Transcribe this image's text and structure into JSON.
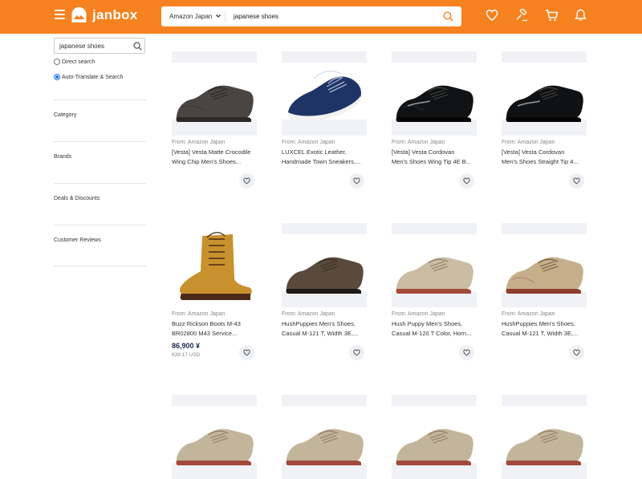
{
  "header": {
    "logo_text": "janbox",
    "brand_color": "#f5821f",
    "search": {
      "store": "Amazon Japan",
      "query": "japanese shoes"
    },
    "icons": [
      "heart-icon",
      "auction-hammer-icon",
      "cart-icon",
      "bell-icon"
    ]
  },
  "sidebar": {
    "search_value": "japanese shoes",
    "search_mode": {
      "options": [
        "Direct search",
        "Auto-Translate & Search"
      ],
      "selected": "Auto-Translate & Search"
    },
    "filters": [
      "Category",
      "Brands",
      "Deals & Discounts",
      "Customer Reviews"
    ]
  },
  "products": [
    {
      "source": "From: Amazon Japan",
      "title_line1": "[Vesta] Vesta Matte Crocodile",
      "title_line2": "Wing Chip Men's Shoes...",
      "shoe": "dark-croc-oxford"
    },
    {
      "source": "From: Amazon Japan",
      "title_line1": "LUXCEL Exotic Leather,",
      "title_line2": "Handmade Town Sneakers,...",
      "shoe": "navy-lace-up"
    },
    {
      "source": "From: Amazon Japan",
      "title_line1": "[Vesta] Vesta Cordovan",
      "title_line2": "Men's Shoes Wing Tip 4E B...",
      "shoe": "black-wingtip"
    },
    {
      "source": "From: Amazon Japan",
      "title_line1": "[Vesta] Vesta Cordovan",
      "title_line2": "Men's Shoes Straight Tip 4...",
      "shoe": "black-straight-tip"
    },
    {
      "source": "From: Amazon Japan",
      "title_line1": "Buzz Rickson Boots M-43",
      "title_line2": "BR02800 M43 Service...",
      "price": "86,900 ¥",
      "price_usd": "639.17 USD",
      "shoe": "tan-boot"
    },
    {
      "source": "From: Amazon Japan",
      "title_line1": "HushPuppies Men's Shoes,",
      "title_line2": "Casual M-121 T, Width 3E,...",
      "shoe": "brown-suede"
    },
    {
      "source": "From: Amazon Japan",
      "title_line1": "Hush Puppy Men's Shoes,",
      "title_line2": "Casual M-120 T Color, Horn...",
      "shoe": "beige-suede"
    },
    {
      "source": "From: Amazon Japan",
      "title_line1": "HushPuppies Men's Shoes,",
      "title_line2": "Casual M-121 T, Width 3E,...",
      "shoe": "beige-wingtip"
    },
    {
      "shoe": "beige-suede-partial"
    },
    {
      "shoe": "beige-suede-partial"
    },
    {
      "shoe": "beige-suede-partial"
    },
    {
      "shoe": "beige-suede-partial"
    }
  ]
}
